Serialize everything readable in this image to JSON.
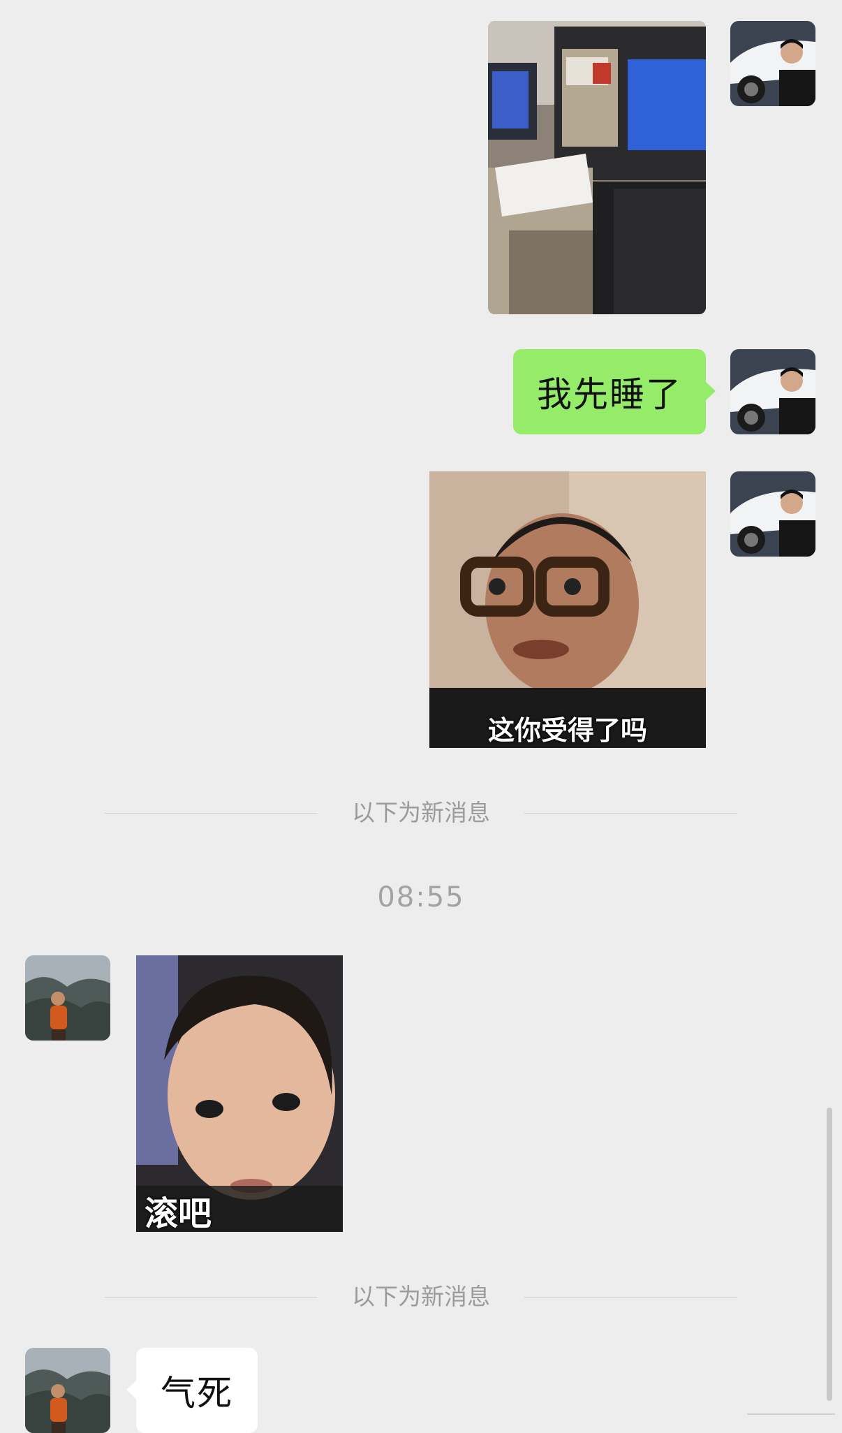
{
  "messages": {
    "me_text_1": "我先睡了",
    "me_sticker_caption": "这你受得了吗",
    "them_sticker_caption": "滚吧",
    "them_text_1": "气死"
  },
  "dividers": {
    "new_messages_1": "以下为新消息",
    "new_messages_2": "以下为新消息"
  },
  "timestamps": {
    "t1": "08:55"
  },
  "icons": {
    "my_avatar": "person-car-avatar",
    "their_avatar": "person-mountain-avatar"
  },
  "colors": {
    "background": "#ededed",
    "my_bubble": "#95ec69",
    "their_bubble": "#ffffff"
  }
}
